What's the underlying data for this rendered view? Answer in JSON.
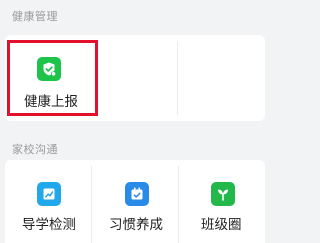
{
  "sections": {
    "health": {
      "title": "健康管理",
      "items": [
        {
          "label": "健康上报",
          "icon": "shield-check-icon",
          "color": "#1ec34a"
        }
      ]
    },
    "home_school": {
      "title": "家校沟通",
      "items": [
        {
          "label": "导学检测",
          "icon": "chart-icon",
          "color": "#20a8ea"
        },
        {
          "label": "习惯养成",
          "icon": "calendar-check-icon",
          "color": "#2a8ae8"
        },
        {
          "label": "班级圈",
          "icon": "sprout-icon",
          "color": "#22b84a"
        }
      ]
    }
  },
  "highlight_color": "#e3102c"
}
